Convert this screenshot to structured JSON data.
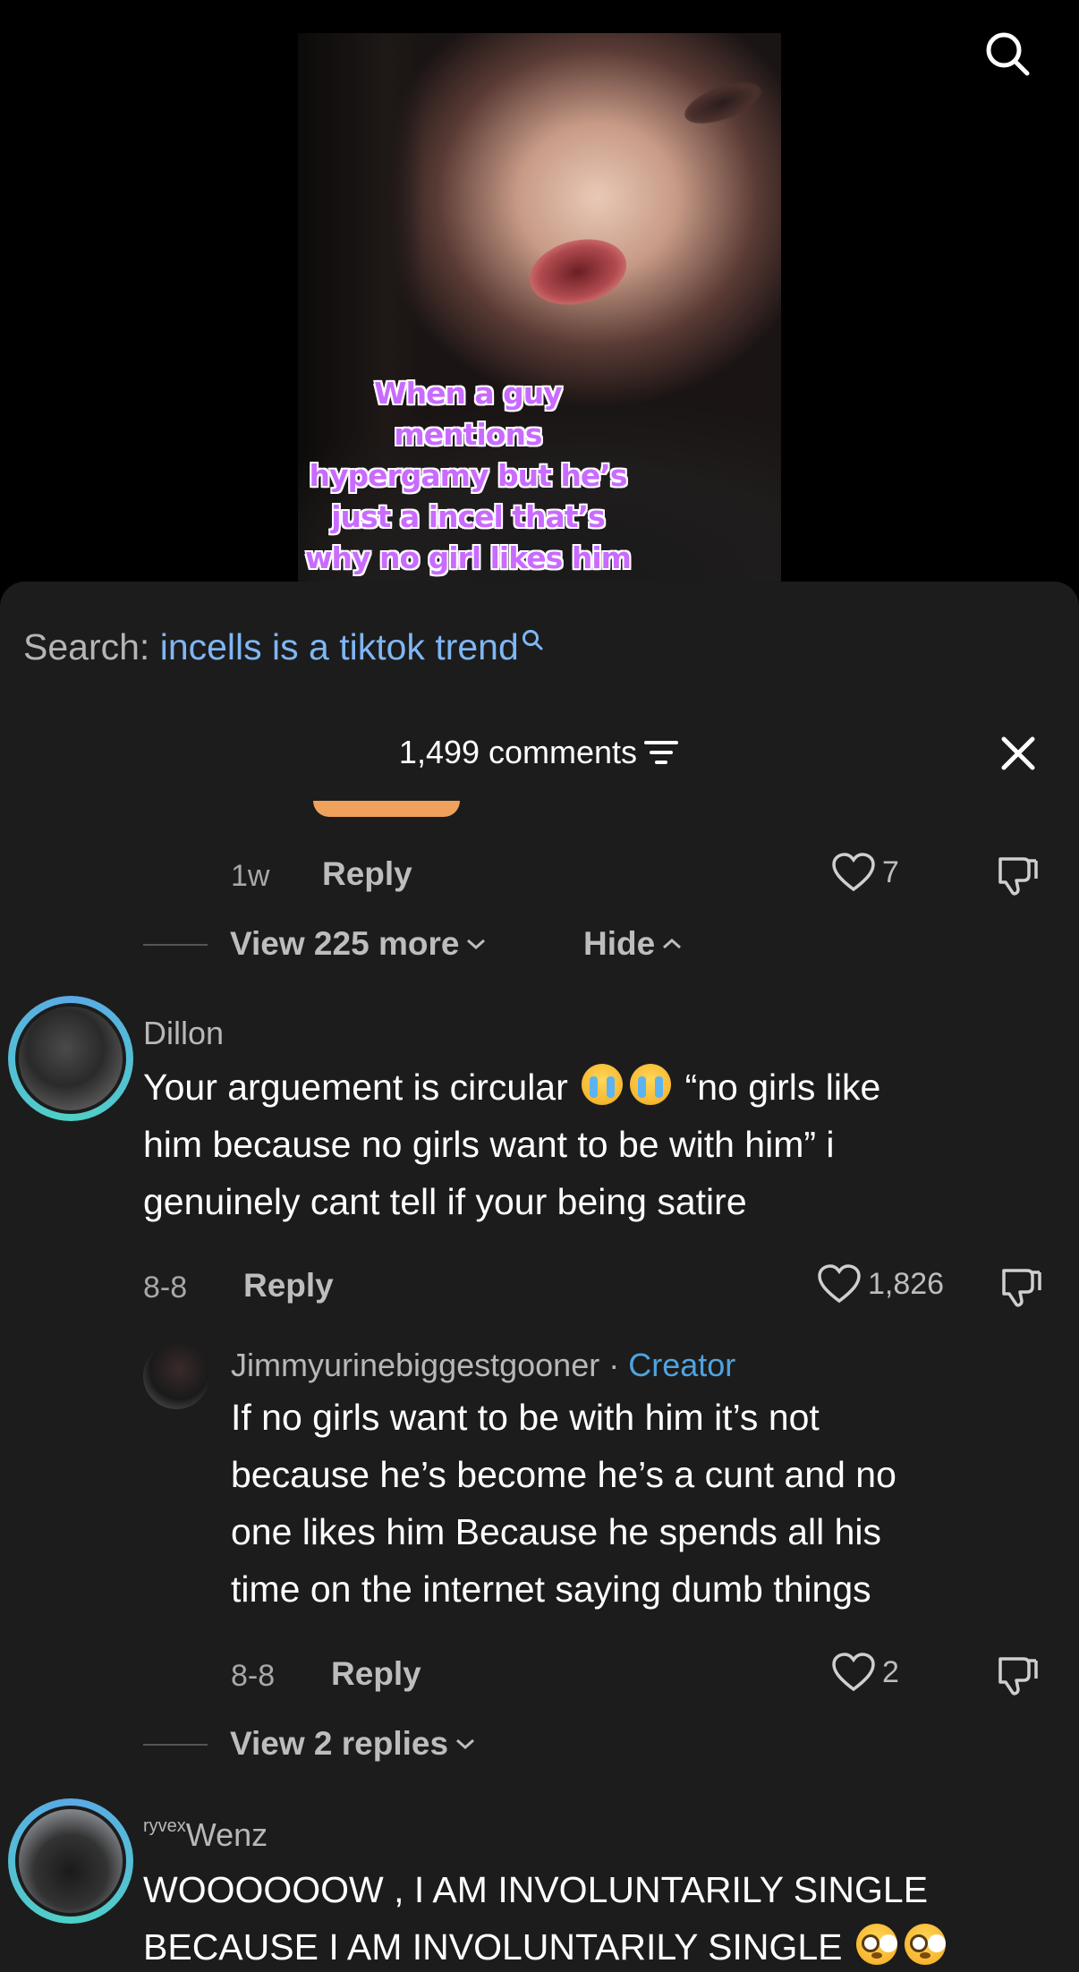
{
  "video": {
    "caption_lines": [
      "When a guy",
      "mentions",
      "hypergamy but he’s",
      "just a incel that’s",
      "why no girl likes him"
    ]
  },
  "search": {
    "label": "Search:",
    "term": "incells is a tiktok trend"
  },
  "comments": {
    "count_label": "1,499 comments"
  },
  "prev_comment": {
    "time": "1w",
    "reply_label": "Reply",
    "likes": "7"
  },
  "thread1_controls": {
    "view_more": "View 225 more",
    "hide": "Hide"
  },
  "comment_dillon": {
    "username": "Dillon",
    "lines": [
      "Your arguement is circular",
      "“no girls like",
      "him because no girls want to be with him” i",
      "genuinely cant tell if your being satire"
    ],
    "date": "8-8",
    "reply_label": "Reply",
    "likes": "1,826"
  },
  "reply_jimmy": {
    "username": "Jimmyurinebiggestgooner",
    "separator": "·",
    "badge": "Creator",
    "lines": [
      "If no girls want to be with him it’s not",
      "because he’s become he’s a cunt and no",
      "one likes him Because he spends all his",
      "time on the internet saying dumb things"
    ],
    "date": "8-8",
    "reply_label": "Reply",
    "likes": "2"
  },
  "thread2_controls": {
    "view_replies": "View 2 replies"
  },
  "comment_wenz": {
    "username_prefix": "ryvex",
    "username": "Wenz",
    "lines": [
      "WOOOOOOW , I AM INVOLUNTARILY SINGLE",
      "BECAUSE I AM INVOLUNTARILY SINGLE"
    ]
  },
  "colors": {
    "sheet_bg": "#1c1c1c",
    "link_blue": "#7fb6f5",
    "creator_blue": "#4fa3e0",
    "caption_purple": "#c96bff"
  },
  "icons": [
    "search-icon",
    "filter-icon",
    "close-icon",
    "heart-icon",
    "dislike-icon",
    "chevron-down-icon",
    "chevron-up-icon",
    "crying-emoji-icon",
    "flushed-emoji-icon"
  ]
}
